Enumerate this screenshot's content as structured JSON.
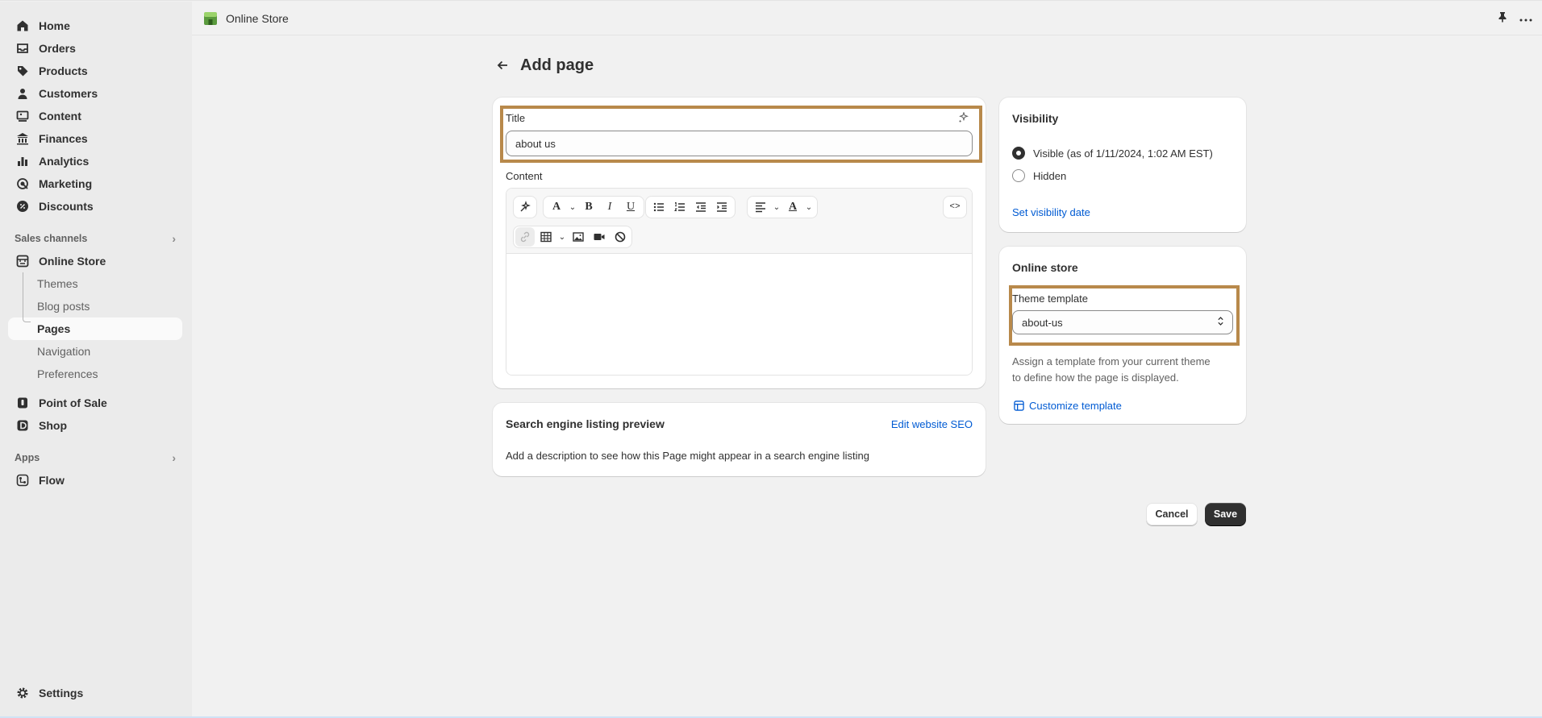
{
  "nav": {
    "items": [
      {
        "label": "Home",
        "icon": "home-icon"
      },
      {
        "label": "Orders",
        "icon": "inbox-icon"
      },
      {
        "label": "Products",
        "icon": "tag-icon"
      },
      {
        "label": "Customers",
        "icon": "person-icon"
      },
      {
        "label": "Content",
        "icon": "image-icon"
      },
      {
        "label": "Finances",
        "icon": "bank-icon"
      },
      {
        "label": "Analytics",
        "icon": "bar-chart-icon"
      },
      {
        "label": "Marketing",
        "icon": "target-icon"
      },
      {
        "label": "Discounts",
        "icon": "discount-icon"
      }
    ],
    "sales_channels_label": "Sales channels",
    "online_store_label": "Online Store",
    "online_store_sub": [
      "Themes",
      "Blog posts",
      "Pages",
      "Navigation",
      "Preferences"
    ],
    "active_sub": "Pages",
    "point_of_sale_label": "Point of Sale",
    "shop_label": "Shop",
    "apps_label": "Apps",
    "flow_label": "Flow",
    "settings_label": "Settings"
  },
  "topbar": {
    "title": "Online Store"
  },
  "page": {
    "title": "Add page"
  },
  "title_field": {
    "label": "Title",
    "value": "about us"
  },
  "content": {
    "label": "Content"
  },
  "seo": {
    "title": "Search engine listing preview",
    "edit_link": "Edit website SEO",
    "description": "Add a description to see how this Page might appear in a search engine listing"
  },
  "visibility": {
    "title": "Visibility",
    "options": [
      "Visible (as of 1/11/2024, 1:02 AM EST)",
      "Hidden"
    ],
    "selected": "Visible (as of 1/11/2024, 1:02 AM EST)",
    "set_date_link": "Set visibility date"
  },
  "online_store_card": {
    "title": "Online store",
    "template_label": "Theme template",
    "template_value": "about-us",
    "help_line1": "Assign a template from your current theme",
    "help_line2": "to define how the page is displayed.",
    "customize_link": "Customize template"
  },
  "actions": {
    "cancel": "Cancel",
    "save": "Save"
  },
  "colors": {
    "highlight": "#b8894b",
    "link": "#005bd3",
    "primary": "#303030"
  }
}
